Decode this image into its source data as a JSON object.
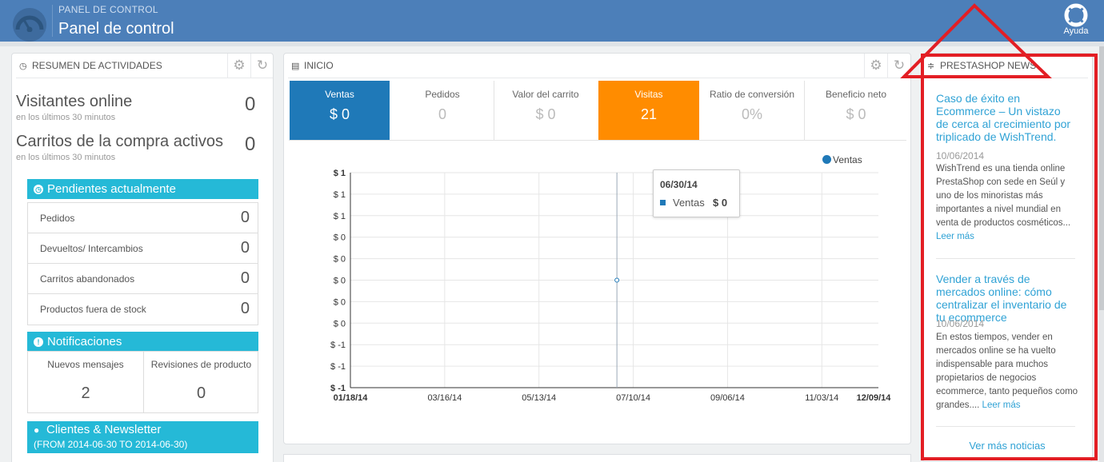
{
  "header": {
    "breadcrumb": "PANEL DE CONTROL",
    "title": "Panel de control",
    "help_label": "Ayuda",
    "bg_color": "#4c7fb9"
  },
  "activity": {
    "title": "RESUMEN DE ACTIVIDADES",
    "visitors_label": "Visitantes online",
    "visitors_sub": "en los últimos 30 minutos",
    "visitors_value": "0",
    "carts_label": "Carritos de la compra activos",
    "carts_sub": "en los últimos 30 minutos",
    "carts_value": "0",
    "pending_title": "Pendientes actualmente",
    "pending_items": [
      {
        "label": "Pedidos",
        "value": "0"
      },
      {
        "label": "Devueltos/ Intercambios",
        "value": "0"
      },
      {
        "label": "Carritos abandonados",
        "value": "0"
      },
      {
        "label": "Productos fuera de stock",
        "value": "0"
      }
    ],
    "notifications_title": "Notificaciones",
    "notifications": [
      {
        "label": "Nuevos mensajes",
        "value": "2"
      },
      {
        "label": "Revisiones de producto",
        "value": "0"
      }
    ],
    "clients_title": "Clientes & Newsletter",
    "clients_range": "(FROM 2014-06-30 TO 2014-06-30)",
    "accent_color": "#25b9d7"
  },
  "inicio": {
    "title": "INICIO",
    "kpis": [
      {
        "label": "Ventas",
        "value": "$ 0",
        "state": "active-blue"
      },
      {
        "label": "Pedidos",
        "value": "0",
        "state": "plain"
      },
      {
        "label": "Valor del carrito",
        "value": "$ 0",
        "state": "plain"
      },
      {
        "label": "Visitas",
        "value": "21",
        "state": "active-orange"
      },
      {
        "label": "Ratio de conversión",
        "value": "0%",
        "state": "plain"
      },
      {
        "label": "Beneficio neto",
        "value": "$ 0",
        "state": "plain"
      }
    ],
    "tooltip": {
      "date": "06/30/14",
      "series": "Ventas",
      "value": "$ 0"
    }
  },
  "chart_data": {
    "type": "line",
    "title": "",
    "xlabel": "",
    "ylabel": "",
    "x_ticks": [
      "01/18/14",
      "03/16/14",
      "05/13/14",
      "07/10/14",
      "09/06/14",
      "11/03/14",
      "12/09/14"
    ],
    "y_ticks": [
      "$ 1",
      "$ 1",
      "$ 1",
      "$ 0",
      "$ 0",
      "$ 0",
      "$ 0",
      "$ 0",
      "$ -1",
      "$ -1",
      "$ -1"
    ],
    "ylim": [
      -1,
      1
    ],
    "series": [
      {
        "name": "Ventas",
        "color": "#1f79b8",
        "points": [
          {
            "x": "06/30/14",
            "y": 0
          }
        ]
      }
    ],
    "legend": "top-right",
    "grid": true
  },
  "news": {
    "title": "PRESTASHOP NEWS",
    "items": [
      {
        "title": "Caso de éxito en Ecommerce – Un vistazo de cerca al crecimiento por triplicado de WishTrend.",
        "date": "10/06/2014",
        "body": "WishTrend es una tienda online PrestaShop con sede en Seúl y uno de los minoristas más importantes a nivel mundial en venta de productos cosméticos...",
        "more": "Leer más"
      },
      {
        "title": "Vender a través de mercados online: cómo centralizar el inventario de tu ecommerce",
        "date": "10/06/2014",
        "body": "En estos tiempos, vender en mercados online se ha vuelto indispensable para muchos propietarios de negocios ecommerce, tanto pequeños como grandes....",
        "more": "Leer más"
      }
    ],
    "see_more": "Ver más noticias",
    "link_color": "#2fa2d5"
  },
  "annotation": {
    "highlight_color": "#e31e24"
  }
}
